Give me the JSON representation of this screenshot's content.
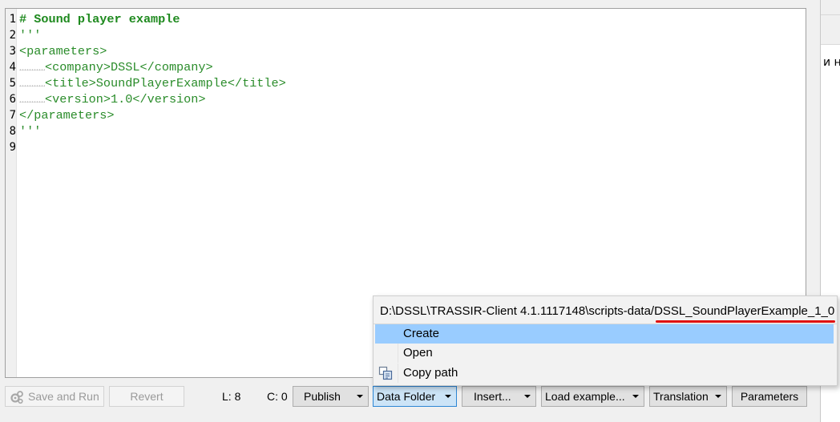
{
  "editor": {
    "lines": [
      {
        "num": "1",
        "text": "# Sound player example"
      },
      {
        "num": "2",
        "text": "'''"
      },
      {
        "num": "3",
        "text": "<parameters>"
      },
      {
        "num": "4",
        "text": "<company>DSSL</company>"
      },
      {
        "num": "5",
        "text": "<title>SoundPlayerExample</title>"
      },
      {
        "num": "6",
        "text": "<version>1.0</version>"
      },
      {
        "num": "7",
        "text": "</parameters>"
      },
      {
        "num": "8",
        "text": "'''"
      },
      {
        "num": "9",
        "text": ""
      }
    ]
  },
  "right_panel": {
    "cut_text": "и н"
  },
  "toolbar": {
    "save_run": "Save and Run",
    "revert": "Revert",
    "line_status": "L: 8",
    "col_status": "C: 0",
    "publish": "Publish",
    "data_folder": "Data Folder",
    "insert": "Insert...",
    "load_example": "Load example...",
    "translation": "Translation",
    "parameters": "Parameters"
  },
  "popup": {
    "path": "D:\\DSSL\\TRASSIR-Client 4.1.1117148\\scripts-data/DSSL_SoundPlayerExample_1_0",
    "items": [
      "Create",
      "Open",
      "Copy path"
    ]
  },
  "colors": {
    "code": "#2a8c2a",
    "highlight": "#99ccff",
    "underline": "#e01010"
  }
}
